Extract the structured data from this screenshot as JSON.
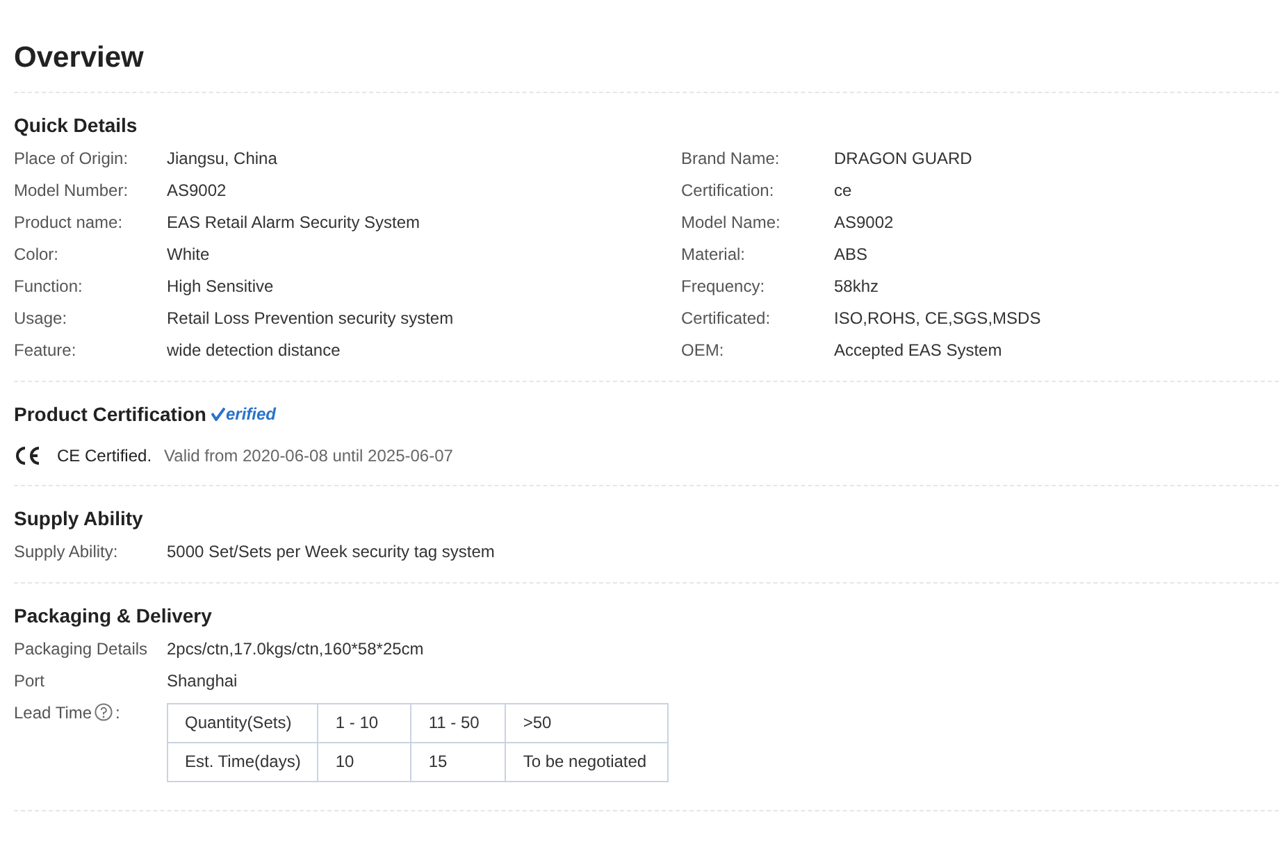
{
  "title": "Overview",
  "quick_details": {
    "title": "Quick Details",
    "rows": [
      {
        "label": "Place of Origin:",
        "value": "Jiangsu, China"
      },
      {
        "label": "Brand Name:",
        "value": "DRAGON GUARD"
      },
      {
        "label": "Model Number:",
        "value": "AS9002"
      },
      {
        "label": "Certification:",
        "value": "ce"
      },
      {
        "label": "Product name:",
        "value": "EAS Retail Alarm Security System"
      },
      {
        "label": "Model Name:",
        "value": "AS9002"
      },
      {
        "label": "Color:",
        "value": "White"
      },
      {
        "label": "Material:",
        "value": "ABS"
      },
      {
        "label": "Function:",
        "value": "High Sensitive"
      },
      {
        "label": "Frequency:",
        "value": "58khz"
      },
      {
        "label": "Usage:",
        "value": "Retail Loss Prevention security system"
      },
      {
        "label": "Certificated:",
        "value": "ISO,ROHS, CE,SGS,MSDS"
      },
      {
        "label": "Feature:",
        "value": "wide detection distance"
      },
      {
        "label": "OEM:",
        "value": "Accepted EAS System"
      }
    ]
  },
  "certification": {
    "title": "Product Certification",
    "badge": "erified",
    "name": "CE Certified.",
    "validity": "Valid from 2020-06-08 until 2025-06-07"
  },
  "supply": {
    "title": "Supply Ability",
    "label": "Supply Ability:",
    "value": "5000 Set/Sets per Week security tag system"
  },
  "packaging": {
    "title": "Packaging & Delivery",
    "rows": [
      {
        "label": "Packaging Details",
        "value": "2pcs/ctn,17.0kgs/ctn,160*58*25cm"
      },
      {
        "label": "Port",
        "value": "Shanghai"
      }
    ],
    "lead_label": "Lead Time",
    "lead_colon": ":",
    "lead_table": [
      [
        "Quantity(Sets)",
        "1 - 10",
        "11 - 50",
        ">50"
      ],
      [
        "Est. Time(days)",
        "10",
        "15",
        "To be negotiated"
      ]
    ]
  }
}
